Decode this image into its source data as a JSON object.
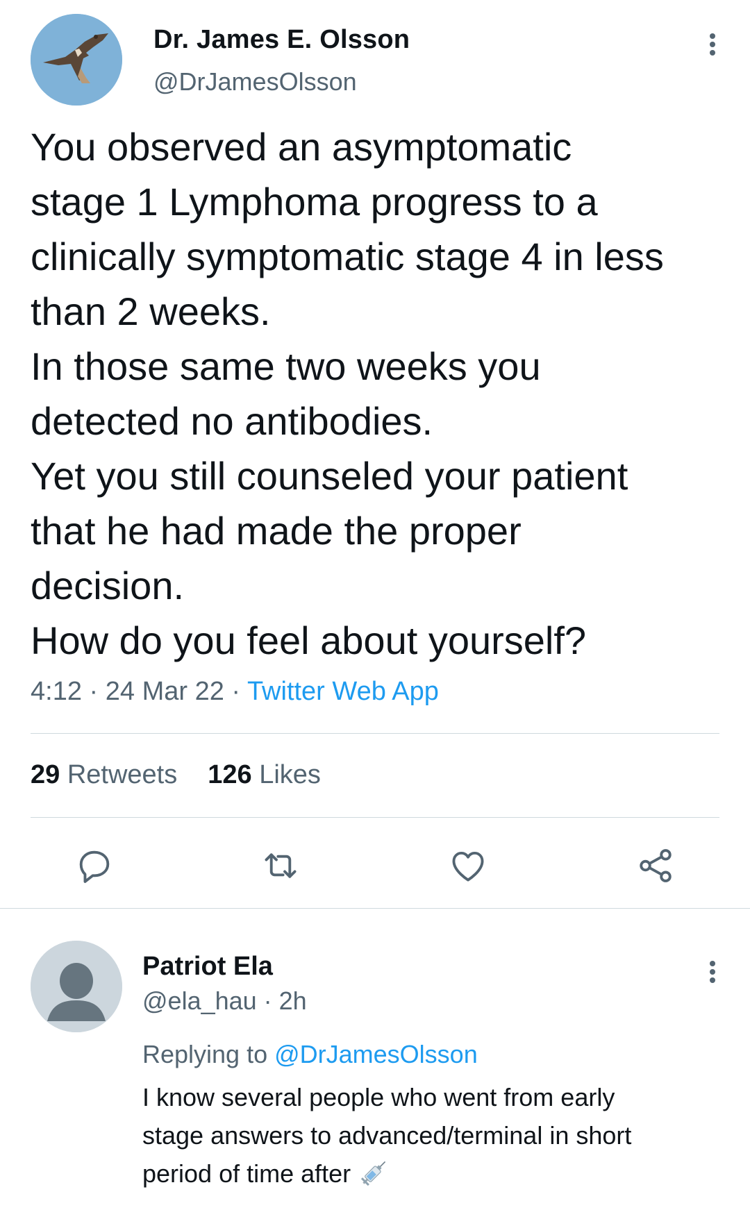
{
  "tweet": {
    "author": {
      "display_name": "Dr. James E. Olsson",
      "handle": "@DrJamesOlsson",
      "avatar_icon": "hawk-avatar-icon"
    },
    "text_lines": [
      "You observed an asymptomatic",
      "stage 1 Lymphoma progress to a",
      "clinically symptomatic stage 4 in less",
      "than 2 weeks.",
      "In those same two weeks you",
      "detected no antibodies.",
      "Yet you still counseled your patient",
      "that he had made the proper",
      "decision.",
      "How do you feel about yourself?"
    ],
    "time": "4:12",
    "sep1": " · ",
    "date": "24 Mar 22",
    "sep2": " · ",
    "source": "Twitter Web App",
    "stats": {
      "retweets_count": "29",
      "retweets_label": " Retweets",
      "likes_count": "126",
      "likes_label": " Likes"
    },
    "actions": [
      "reply-icon",
      "retweet-icon",
      "like-icon",
      "share-icon"
    ],
    "more_icon": "more-vertical-icon"
  },
  "reply": {
    "author": {
      "display_name": "Patriot Ela",
      "handle": "@ela_hau",
      "time": " · 2h",
      "avatar_icon": "default-avatar-icon"
    },
    "replying_prefix": "Replying to ",
    "replying_to": "@DrJamesOlsson",
    "text_lines": [
      "I know several people who went from early",
      "stage answers to advanced/terminal in short",
      "period of time after"
    ],
    "emoji_icon": "syringe-icon",
    "more_icon": "more-vertical-icon"
  },
  "colors": {
    "text": "#0f1419",
    "secondary": "#536471",
    "link": "#1d9bf0",
    "divider": "#cfd9de"
  }
}
